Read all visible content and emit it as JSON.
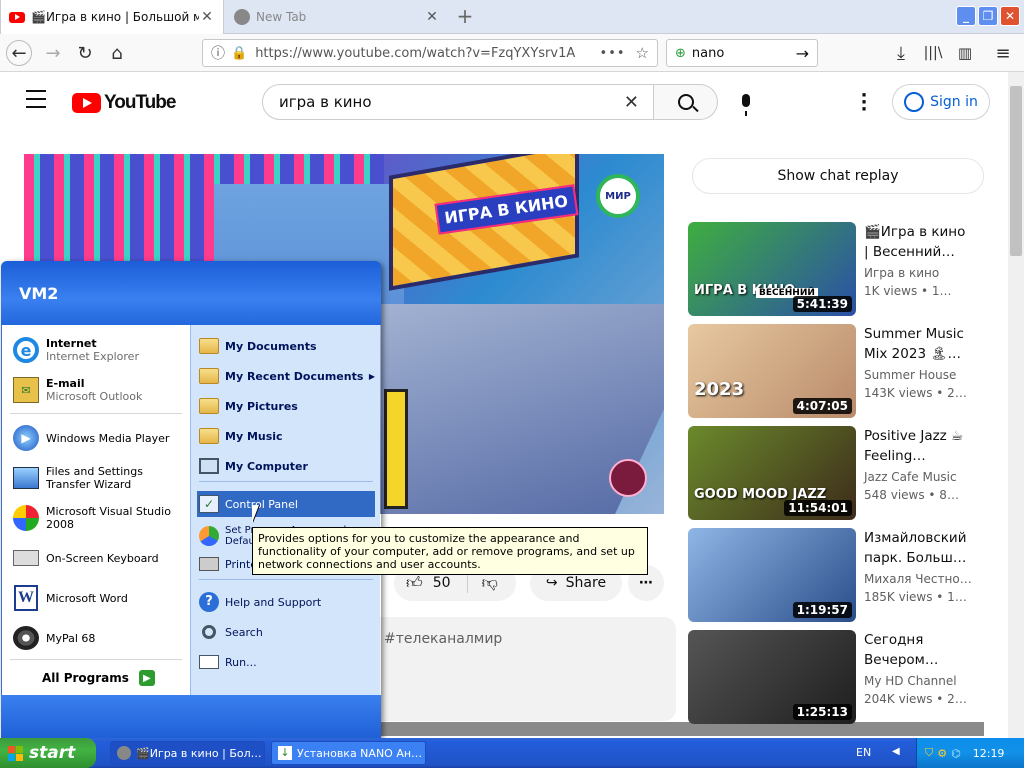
{
  "browser": {
    "tabs": [
      {
        "label": "🎬Игра в кино | Большой мараф"
      },
      {
        "label": "New Tab"
      }
    ],
    "url": "https://www.youtube.com/watch?v=FzqYXYsrv1A",
    "search_value": "nano"
  },
  "youtube": {
    "logo_text": "YouTube",
    "search_value": "игра в кино",
    "sign_in": "Sign in",
    "chat_replay": "Show chat replay",
    "likes": "50",
    "share": "Share",
    "hashtag": "#телеканалмир",
    "overlay_badge": "МИР",
    "overlay_title": "ИГРА В КИНО",
    "related": [
      {
        "title": "🎬Игра в кино | Весенний…",
        "channel": "Игра в кино",
        "views": "1K views • 1…",
        "duration": "5:41:39",
        "badge": "ВЕСЕННИЙ",
        "thumb_text": "ИГРА В КИНО",
        "c1": "#3fae3f",
        "c2": "#2b4fa8"
      },
      {
        "title": "Summer Music Mix 2023 🏝…",
        "channel": "Summer House",
        "views": "143K views • 2…",
        "duration": "4:07:05",
        "badge": "",
        "thumb_text": "2023",
        "c1": "#e7c9a0",
        "c2": "#b98a6a"
      },
      {
        "title": "Positive Jazz ☕ Feeling…",
        "channel": "Jazz Cafe Music",
        "views": "548 views • 8…",
        "duration": "11:54:01",
        "badge": "",
        "thumb_text": "GOOD MOOD JAZZ",
        "c1": "#6b8a2c",
        "c2": "#3d2b1a"
      },
      {
        "title": "Измайловский парк. Больш…",
        "channel": "Михаля Честно…",
        "views": "185K views • 1…",
        "duration": "1:19:57",
        "badge": "",
        "thumb_text": "",
        "c1": "#8fb6e6",
        "c2": "#2a4e8a"
      },
      {
        "title": "Сегодня Вечером…",
        "channel": "My HD Channel",
        "views": "204K views • 2…",
        "duration": "1:25:13",
        "badge": "",
        "thumb_text": "",
        "c1": "#555555",
        "c2": "#1e1e1e"
      }
    ]
  },
  "start_menu": {
    "user": "VM2",
    "pinned": [
      {
        "name": "Internet",
        "sub": "Internet Explorer",
        "icon": "ie-icon"
      },
      {
        "name": "E-mail",
        "sub": "Microsoft Outlook",
        "icon": "outlook-icon"
      }
    ],
    "recent": [
      {
        "name": "Windows Media Player",
        "icon": "media-player-icon"
      },
      {
        "name": "Files and Settings Transfer Wizard",
        "icon": "transfer-wizard-icon"
      },
      {
        "name": "Microsoft Visual Studio 2008",
        "icon": "visual-studio-icon"
      },
      {
        "name": "On-Screen Keyboard",
        "icon": "keyboard-icon"
      },
      {
        "name": "Microsoft Word",
        "icon": "word-icon"
      },
      {
        "name": "MyPal 68",
        "icon": "mypal-icon"
      }
    ],
    "all_programs": "All Programs",
    "right": [
      {
        "name": "My Documents"
      },
      {
        "name": "My Recent Documents"
      },
      {
        "name": "My Pictures"
      },
      {
        "name": "My Music"
      },
      {
        "name": "My Computer"
      },
      {
        "name": "Control Panel"
      },
      {
        "name": "Set Program Access and Defaults"
      },
      {
        "name": "Printers and Faxes"
      },
      {
        "name": "Help and Support"
      },
      {
        "name": "Search"
      },
      {
        "name": "Run..."
      }
    ],
    "tooltip": "Provides options for you to customize the appearance and functionality of your computer, add or remove programs, and set up network connections and user accounts."
  },
  "taskbar": {
    "start": "start",
    "items": [
      {
        "label": "🎬Игра в кино | Бол…"
      },
      {
        "label": "Установка NANO Ан…"
      }
    ],
    "lang": "EN",
    "clock": "12:19"
  },
  "colors": {
    "yt_red": "#ff0000",
    "xp_blue": "#245edb",
    "xp_green": "#3c9a3c",
    "selection": "#316ac5"
  }
}
